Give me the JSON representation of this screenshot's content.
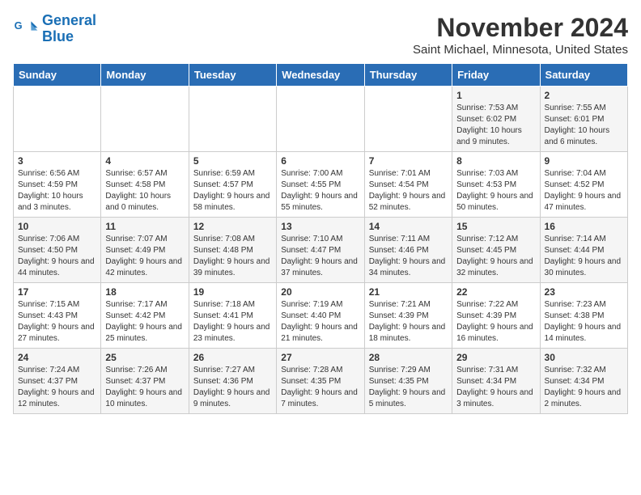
{
  "logo": {
    "line1": "General",
    "line2": "Blue"
  },
  "title": "November 2024",
  "location": "Saint Michael, Minnesota, United States",
  "days_of_week": [
    "Sunday",
    "Monday",
    "Tuesday",
    "Wednesday",
    "Thursday",
    "Friday",
    "Saturday"
  ],
  "weeks": [
    [
      {
        "day": "",
        "info": ""
      },
      {
        "day": "",
        "info": ""
      },
      {
        "day": "",
        "info": ""
      },
      {
        "day": "",
        "info": ""
      },
      {
        "day": "",
        "info": ""
      },
      {
        "day": "1",
        "info": "Sunrise: 7:53 AM\nSunset: 6:02 PM\nDaylight: 10 hours and 9 minutes."
      },
      {
        "day": "2",
        "info": "Sunrise: 7:55 AM\nSunset: 6:01 PM\nDaylight: 10 hours and 6 minutes."
      }
    ],
    [
      {
        "day": "3",
        "info": "Sunrise: 6:56 AM\nSunset: 4:59 PM\nDaylight: 10 hours and 3 minutes."
      },
      {
        "day": "4",
        "info": "Sunrise: 6:57 AM\nSunset: 4:58 PM\nDaylight: 10 hours and 0 minutes."
      },
      {
        "day": "5",
        "info": "Sunrise: 6:59 AM\nSunset: 4:57 PM\nDaylight: 9 hours and 58 minutes."
      },
      {
        "day": "6",
        "info": "Sunrise: 7:00 AM\nSunset: 4:55 PM\nDaylight: 9 hours and 55 minutes."
      },
      {
        "day": "7",
        "info": "Sunrise: 7:01 AM\nSunset: 4:54 PM\nDaylight: 9 hours and 52 minutes."
      },
      {
        "day": "8",
        "info": "Sunrise: 7:03 AM\nSunset: 4:53 PM\nDaylight: 9 hours and 50 minutes."
      },
      {
        "day": "9",
        "info": "Sunrise: 7:04 AM\nSunset: 4:52 PM\nDaylight: 9 hours and 47 minutes."
      }
    ],
    [
      {
        "day": "10",
        "info": "Sunrise: 7:06 AM\nSunset: 4:50 PM\nDaylight: 9 hours and 44 minutes."
      },
      {
        "day": "11",
        "info": "Sunrise: 7:07 AM\nSunset: 4:49 PM\nDaylight: 9 hours and 42 minutes."
      },
      {
        "day": "12",
        "info": "Sunrise: 7:08 AM\nSunset: 4:48 PM\nDaylight: 9 hours and 39 minutes."
      },
      {
        "day": "13",
        "info": "Sunrise: 7:10 AM\nSunset: 4:47 PM\nDaylight: 9 hours and 37 minutes."
      },
      {
        "day": "14",
        "info": "Sunrise: 7:11 AM\nSunset: 4:46 PM\nDaylight: 9 hours and 34 minutes."
      },
      {
        "day": "15",
        "info": "Sunrise: 7:12 AM\nSunset: 4:45 PM\nDaylight: 9 hours and 32 minutes."
      },
      {
        "day": "16",
        "info": "Sunrise: 7:14 AM\nSunset: 4:44 PM\nDaylight: 9 hours and 30 minutes."
      }
    ],
    [
      {
        "day": "17",
        "info": "Sunrise: 7:15 AM\nSunset: 4:43 PM\nDaylight: 9 hours and 27 minutes."
      },
      {
        "day": "18",
        "info": "Sunrise: 7:17 AM\nSunset: 4:42 PM\nDaylight: 9 hours and 25 minutes."
      },
      {
        "day": "19",
        "info": "Sunrise: 7:18 AM\nSunset: 4:41 PM\nDaylight: 9 hours and 23 minutes."
      },
      {
        "day": "20",
        "info": "Sunrise: 7:19 AM\nSunset: 4:40 PM\nDaylight: 9 hours and 21 minutes."
      },
      {
        "day": "21",
        "info": "Sunrise: 7:21 AM\nSunset: 4:39 PM\nDaylight: 9 hours and 18 minutes."
      },
      {
        "day": "22",
        "info": "Sunrise: 7:22 AM\nSunset: 4:39 PM\nDaylight: 9 hours and 16 minutes."
      },
      {
        "day": "23",
        "info": "Sunrise: 7:23 AM\nSunset: 4:38 PM\nDaylight: 9 hours and 14 minutes."
      }
    ],
    [
      {
        "day": "24",
        "info": "Sunrise: 7:24 AM\nSunset: 4:37 PM\nDaylight: 9 hours and 12 minutes."
      },
      {
        "day": "25",
        "info": "Sunrise: 7:26 AM\nSunset: 4:37 PM\nDaylight: 9 hours and 10 minutes."
      },
      {
        "day": "26",
        "info": "Sunrise: 7:27 AM\nSunset: 4:36 PM\nDaylight: 9 hours and 9 minutes."
      },
      {
        "day": "27",
        "info": "Sunrise: 7:28 AM\nSunset: 4:35 PM\nDaylight: 9 hours and 7 minutes."
      },
      {
        "day": "28",
        "info": "Sunrise: 7:29 AM\nSunset: 4:35 PM\nDaylight: 9 hours and 5 minutes."
      },
      {
        "day": "29",
        "info": "Sunrise: 7:31 AM\nSunset: 4:34 PM\nDaylight: 9 hours and 3 minutes."
      },
      {
        "day": "30",
        "info": "Sunrise: 7:32 AM\nSunset: 4:34 PM\nDaylight: 9 hours and 2 minutes."
      }
    ]
  ]
}
